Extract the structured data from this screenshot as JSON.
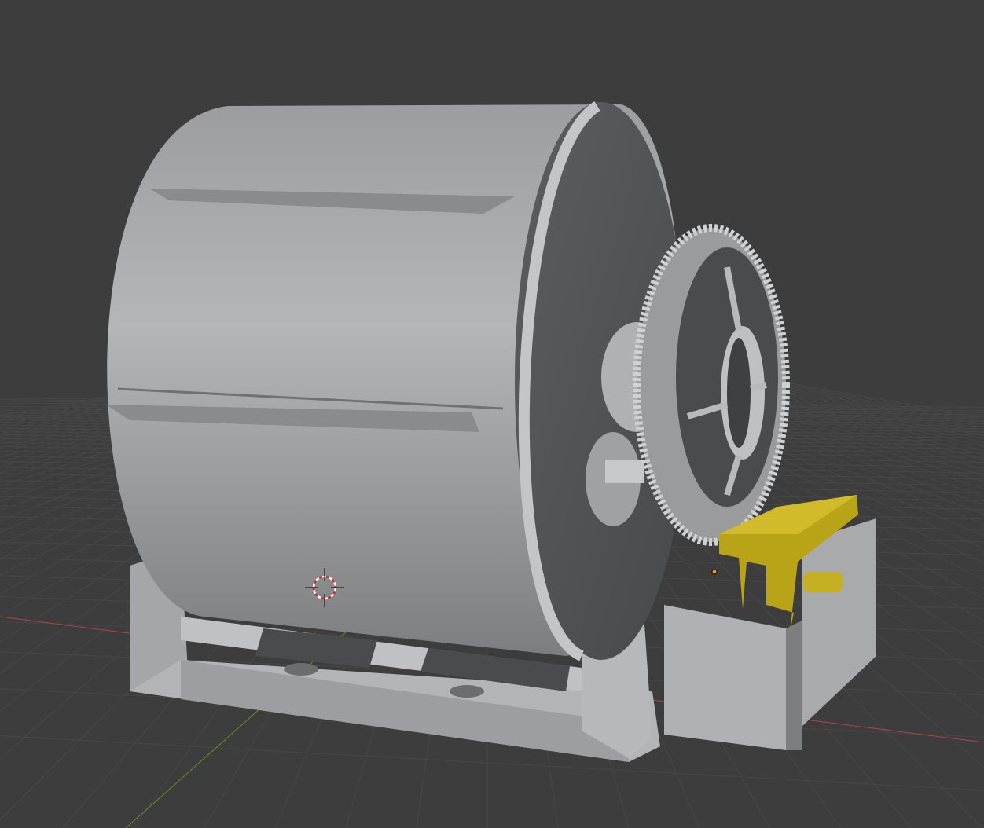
{
  "viewport": {
    "background_color": "#3d3d3d",
    "grid_color": "#474747",
    "x_axis_color": "#b5414a",
    "y_axis_color": "#6b8e23"
  },
  "model": {
    "body_color": "#a9aaab",
    "shadow_color": "#575859",
    "selected_part_color": "#b9a417",
    "selected_part_state": "selected"
  },
  "cursor": {
    "icon": "3d-cursor-icon"
  }
}
